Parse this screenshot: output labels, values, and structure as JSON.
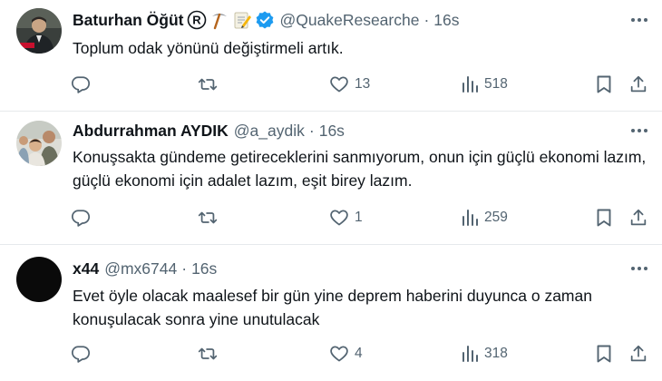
{
  "tweets": [
    {
      "name": "Baturhan Öğüt",
      "handle": "@QuakeResearche",
      "separator": "·",
      "time": "16s",
      "text": "Toplum odak yönünü değiştirmeli artık.",
      "replies": "",
      "retweets": "",
      "likes": "13",
      "views": "518",
      "verified": true,
      "name_emojis": [
        "registered-icon",
        "pickaxe-icon",
        "memo-icon"
      ]
    },
    {
      "name": "Abdurrahman AYDIK",
      "handle": "@a_aydik",
      "separator": "·",
      "time": "16s",
      "text": "Konuşsakta gündeme getireceklerini sanmıyorum, onun için güçlü ekonomi lazım, güçlü ekonomi için adalet lazım, eşit birey lazım.",
      "replies": "",
      "retweets": "",
      "likes": "1",
      "views": "259"
    },
    {
      "name": "x44",
      "handle": "@mx6744",
      "separator": "·",
      "time": "16s",
      "text": "Evet öyle olacak maalesef bir gün yine deprem haberini duyunca o zaman konuşulacak sonra yine unutulacak",
      "replies": "",
      "retweets": "",
      "likes": "4",
      "views": "318"
    }
  ],
  "colors": {
    "text": "#0f1419",
    "muted": "#536471",
    "verified": "#1d9bf0",
    "divider": "#e6e9ec"
  }
}
